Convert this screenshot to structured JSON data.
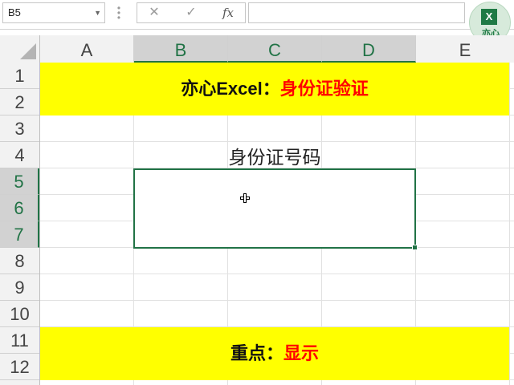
{
  "formula_bar": {
    "name_box": "B5",
    "cancel_icon": "✕",
    "enter_icon": "✓",
    "fx_label": "fx",
    "formula": ""
  },
  "logo": {
    "mark": "X",
    "text": "亦心"
  },
  "columns": [
    "A",
    "B",
    "C",
    "D",
    "E"
  ],
  "rows": [
    "1",
    "2",
    "3",
    "4",
    "5",
    "6",
    "7",
    "8",
    "9",
    "10",
    "11",
    "12"
  ],
  "selected": {
    "column_range": [
      "B",
      "C",
      "D"
    ],
    "row_range": [
      "5",
      "6",
      "7"
    ]
  },
  "cells": {
    "title_prefix": "亦心Excel：",
    "title_highlight": "身份证验证",
    "id_header": "身份证号码",
    "footer_prefix": "重点：",
    "footer_highlight": "显示"
  },
  "colors": {
    "banner_bg": "#ffff00",
    "highlight_text": "#ff0000",
    "selection_border": "#217346"
  },
  "icons": [
    "namebox-dropdown-icon",
    "cancel-icon",
    "enter-icon",
    "function-icon",
    "plus-cursor-icon"
  ]
}
